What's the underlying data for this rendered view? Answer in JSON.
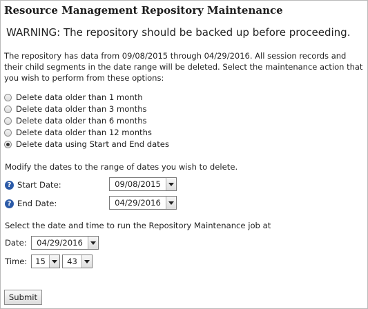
{
  "title": "Resource Management Repository Maintenance",
  "warning": "WARNING: The repository should be backed up before proceeding.",
  "info": "The repository has data from 09/08/2015 through 04/29/2016. All session records and their child segments in the date range will be deleted. Select the maintenance action that you wish to perform from these options:",
  "options": [
    {
      "label": "Delete data older than 1 month",
      "checked": false
    },
    {
      "label": "Delete data older than 3 months",
      "checked": false
    },
    {
      "label": "Delete data older than 6 months",
      "checked": false
    },
    {
      "label": "Delete data older than 12 months",
      "checked": false
    },
    {
      "label": "Delete data using Start and End dates",
      "checked": true
    }
  ],
  "range": {
    "instruction": "Modify the dates to the range of dates you wish to delete.",
    "start_label": "Start Date:",
    "start_value": "09/08/2015",
    "end_label": "End Date:",
    "end_value": "04/29/2016",
    "help_icon": "?"
  },
  "schedule": {
    "instruction": "Select the date and time to run the Repository Maintenance job at",
    "date_label": "Date:",
    "date_value": "04/29/2016",
    "time_label": "Time:",
    "hour_value": "15",
    "minute_value": "43"
  },
  "submit_label": "Submit",
  "icons": {
    "help": "help-icon",
    "dropdown": "chevron-down-icon"
  },
  "colors": {
    "help_icon": "#2c5ba8",
    "text": "#222222"
  }
}
